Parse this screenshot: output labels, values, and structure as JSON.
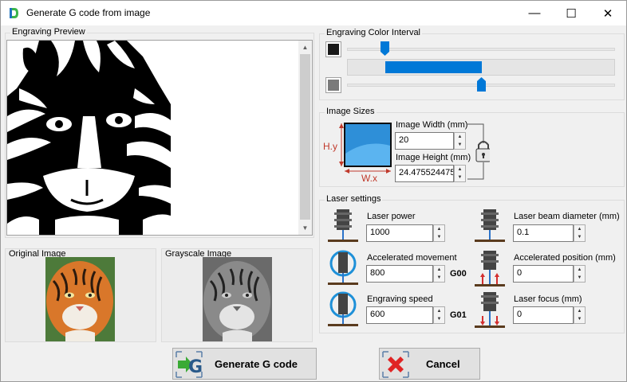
{
  "window": {
    "title": "Generate G code from image"
  },
  "title_controls": {
    "minimize": "—",
    "maximize": "☐",
    "close": "✕"
  },
  "preview": {
    "title": "Engraving Preview"
  },
  "thumbnails": {
    "original_title": "Original Image",
    "grayscale_title": "Grayscale Image"
  },
  "color_interval": {
    "title": "Engraving Color Interval",
    "low_color": "#1a1a1a",
    "high_color": "#7a7a7a",
    "low_value": 0.14,
    "high_value": 0.5
  },
  "image_sizes": {
    "title": "Image Sizes",
    "width_label": "Image Width (mm)",
    "width_value": "20",
    "height_label": "Image Height (mm)",
    "height_value": "24.475524475",
    "hy_label": "H.y",
    "wx_label": "W.x"
  },
  "laser": {
    "title": "Laser settings",
    "power_label": "Laser power",
    "power_value": "1000",
    "accel_move_label": "Accelerated movement",
    "accel_move_value": "800",
    "accel_move_code": "G00",
    "engrave_speed_label": "Engraving speed",
    "engrave_speed_value": "600",
    "engrave_speed_code": "G01",
    "beam_label": "Laser beam diameter (mm)",
    "beam_value": "0.1",
    "accel_pos_label": "Accelerated position (mm)",
    "accel_pos_value": "0",
    "focus_label": "Laser focus (mm)",
    "focus_value": "0"
  },
  "buttons": {
    "generate": "Generate G code",
    "cancel": "Cancel"
  },
  "colors": {
    "accent": "#0078d7",
    "tiger_orange": "#d9772a"
  }
}
